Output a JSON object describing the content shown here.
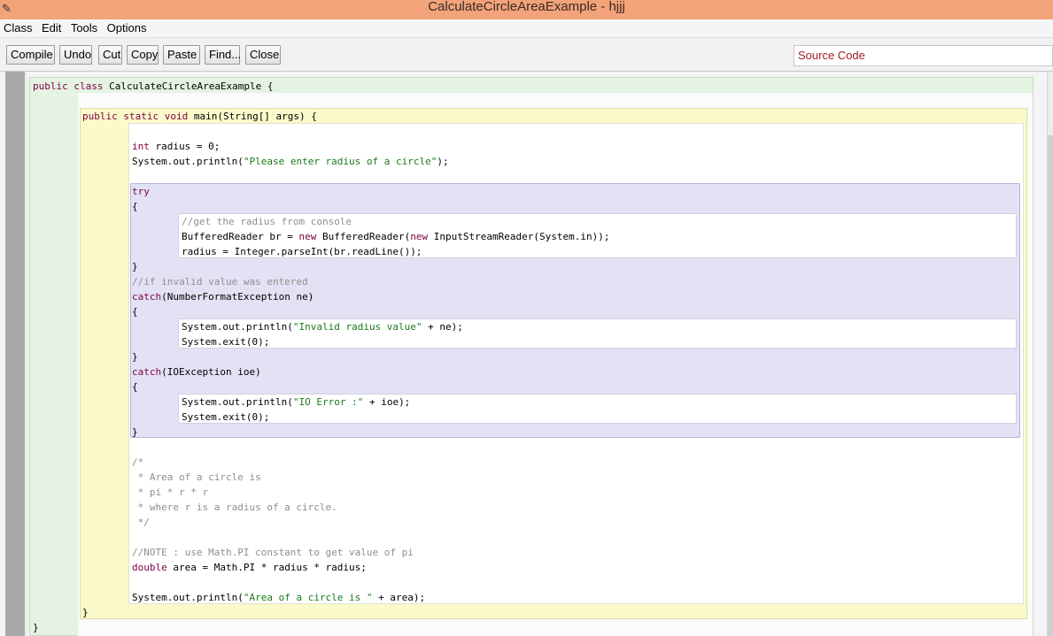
{
  "window": {
    "title": "CalculateCircleAreaExample - hjjj"
  },
  "menu": [
    "Class",
    "Edit",
    "Tools",
    "Options"
  ],
  "toolbar": {
    "compile": "Compile",
    "undo": "Undo",
    "cut": "Cut",
    "copy": "Copy",
    "paste": "Paste",
    "find": "Find...",
    "close": "Close",
    "view_mode": "Source Code"
  },
  "code": {
    "class_decl": {
      "kw": "public class",
      "rest": " CalculateCircleAreaExample {"
    },
    "main_decl": {
      "kw": "public static void",
      "rest": " main(String[] args) {"
    },
    "int_kw": "int",
    "radius_init": " radius = 0;",
    "println_prompt_pre": "System.out.println(",
    "println_prompt_str": "\"Please enter radius of a circle\"",
    "println_prompt_post": ");",
    "try_kw": "try",
    "open_brace": "{",
    "close_brace": "}",
    "comment_radius": "//get the radius from console",
    "br_pre": "BufferedReader br = ",
    "new_kw": "new",
    "br_mid": " BufferedReader(",
    "br_post": " InputStreamReader(System.in));",
    "parse_line": "radius = Integer.parseInt(br.readLine());",
    "comment_invalid": "//if invalid value was entered",
    "catch_kw": "catch",
    "catch_nfe_rest": "(NumberFormatException ne)",
    "println_pre": "System.out.println(",
    "invalid_str": "\"Invalid radius value\"",
    "invalid_post": " + ne);",
    "exit_line": "System.exit(0);",
    "catch_io_rest": "(IOException ioe)",
    "io_str": "\"IO Error :\"",
    "io_post": " + ioe);",
    "doc_comment": [
      "/*",
      " * Area of a circle is",
      " * pi * r * r",
      " * where r is a radius of a circle.",
      " */"
    ],
    "comment_note": "//NOTE : use Math.PI constant to get value of pi",
    "double_kw": "double",
    "area_rest": " area = Math.PI * radius * radius;",
    "area_str": "\"Area of a circle is \"",
    "area_post": " + area);"
  }
}
